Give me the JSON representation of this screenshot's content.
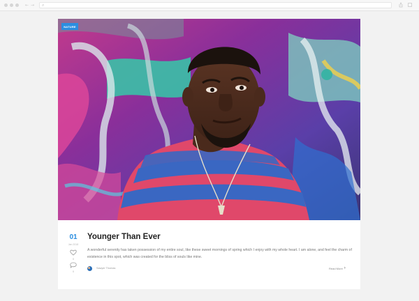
{
  "browser": {
    "back_glyph": "←",
    "forward_glyph": "→",
    "url_search_glyph": "⌕"
  },
  "post": {
    "category_badge": "NATURE",
    "day": "01",
    "month": "Jan 2018",
    "like_count": "0",
    "comment_count": "0",
    "title": "Younger Than Ever",
    "excerpt": "A wonderful serenity has taken possession of my entire soul, like these sweet mornings of spring which I enjoy with my whole heart. I am alone, and feel the charm of existence in this spot, which was created for the bliss of souls like mine.",
    "author": "Sawyer Thomas",
    "read_more": "Read More",
    "read_more_icon": "›"
  },
  "colors": {
    "accent": "#2b8ee0",
    "page_bg": "#f2f2f2",
    "card_bg": "#ffffff",
    "title": "#222222",
    "muted_text": "#777777"
  },
  "icons": [
    "search-icon",
    "heart-icon",
    "comment-icon",
    "chevron-right-icon",
    "share-icon",
    "bookmark-icon"
  ]
}
